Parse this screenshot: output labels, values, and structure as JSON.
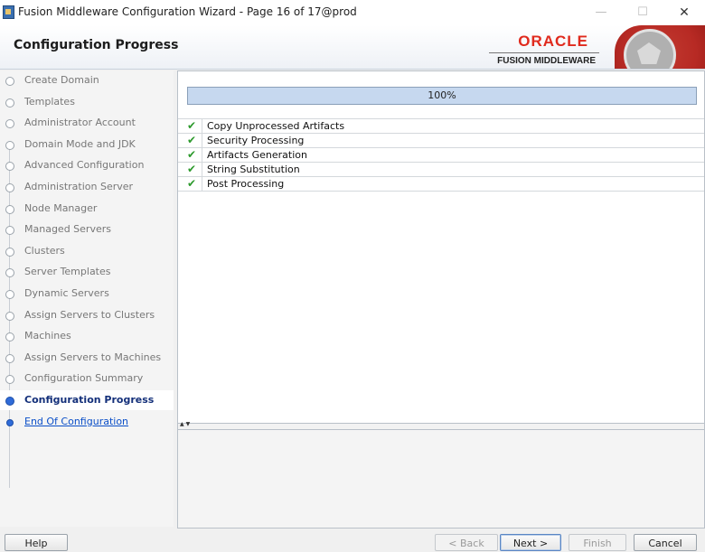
{
  "window": {
    "title": "Fusion Middleware Configuration Wizard - Page 16 of 17@prod",
    "minimize_glyph": "—",
    "maximize_glyph": "☐",
    "close_glyph": "✕"
  },
  "header": {
    "title": "Configuration Progress",
    "brand_name": "ORACLE",
    "brand_sub": "FUSION MIDDLEWARE"
  },
  "nav": {
    "items": [
      {
        "label": "Create Domain",
        "state": "done"
      },
      {
        "label": "Templates",
        "state": "done"
      },
      {
        "label": "Administrator Account",
        "state": "done"
      },
      {
        "label": "Domain Mode and JDK",
        "state": "done"
      },
      {
        "label": "Advanced Configuration",
        "state": "done"
      },
      {
        "label": "Administration Server",
        "state": "done"
      },
      {
        "label": "Node Manager",
        "state": "done"
      },
      {
        "label": "Managed Servers",
        "state": "done"
      },
      {
        "label": "Clusters",
        "state": "done"
      },
      {
        "label": "Server Templates",
        "state": "done"
      },
      {
        "label": "Dynamic Servers",
        "state": "done"
      },
      {
        "label": "Assign Servers to Clusters",
        "state": "done"
      },
      {
        "label": "Machines",
        "state": "done"
      },
      {
        "label": "Assign Servers to Machines",
        "state": "done"
      },
      {
        "label": "Configuration Summary",
        "state": "done"
      },
      {
        "label": "Configuration Progress",
        "state": "active"
      },
      {
        "label": "End Of Configuration",
        "state": "next"
      }
    ]
  },
  "progress": {
    "text": "100%",
    "value": 1.0
  },
  "tasks": [
    {
      "label": "Copy Unprocessed Artifacts",
      "status": "complete"
    },
    {
      "label": "Security Processing",
      "status": "complete"
    },
    {
      "label": "Artifacts Generation",
      "status": "complete"
    },
    {
      "label": "String Substitution",
      "status": "complete"
    },
    {
      "label": "Post Processing",
      "status": "complete"
    }
  ],
  "icons": {
    "check": "✔",
    "check_name": "check-icon"
  },
  "colors": {
    "brand_red": "#e02a1d",
    "active_nav": "#14307a",
    "link": "#0b4fc8",
    "check_green": "#2d9a2d"
  },
  "footer": {
    "help": "Help",
    "back": "< Back",
    "next": "Next >",
    "finish": "Finish",
    "cancel": "Cancel"
  }
}
